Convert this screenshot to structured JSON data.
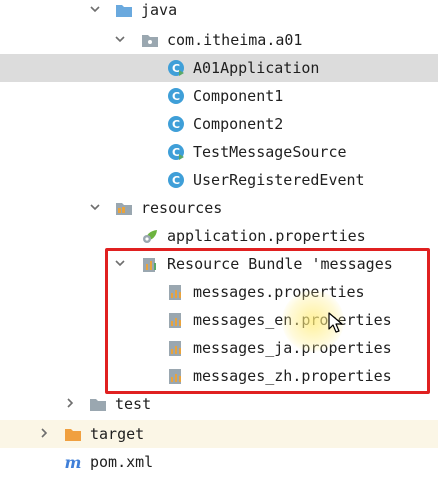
{
  "tree": {
    "java": "java",
    "package": "com.itheima.a01",
    "classes": [
      "A01Application",
      "Component1",
      "Component2",
      "TestMessageSource",
      "UserRegisteredEvent"
    ],
    "resources": "resources",
    "app_properties": "application.properties",
    "bundle": "Resource Bundle 'messages",
    "bundle_files": [
      "messages.properties",
      "messages_en.properties",
      "messages_ja.properties",
      "messages_zh.properties"
    ],
    "test": "test",
    "target": "target",
    "pom": "pom.xml"
  },
  "colors": {
    "selection": "#dcdcdc",
    "highlight_border": "#e02020",
    "class_icon": "#3f9fd8",
    "folder_blue": "#6aa9de",
    "folder_orange": "#f0a040"
  },
  "icons": {
    "expanded": "chevron-down-icon",
    "collapsed": "chevron-right-icon",
    "class": "java-class-icon",
    "properties": "properties-file-icon",
    "folder": "folder-icon"
  }
}
